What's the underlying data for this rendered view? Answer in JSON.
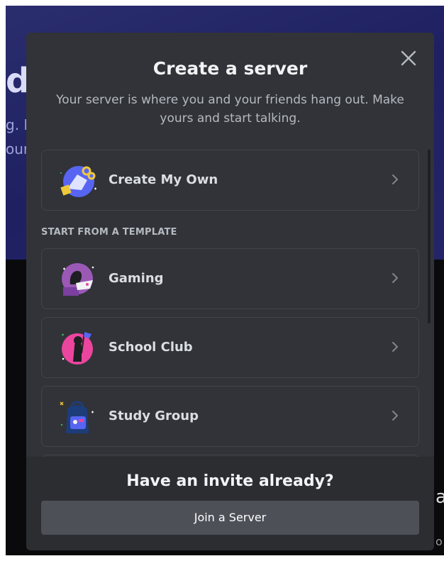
{
  "background": {
    "left_fragment_1": "d",
    "left_fragment_2": "g. F",
    "left_fragment_3": "our",
    "right_fragment_1": "a",
    "right_fragment_2": "o"
  },
  "modal": {
    "title": "Create a server",
    "subtitle": "Your server is where you and your friends hang out. Make yours and start talking.",
    "close_icon": "close-icon"
  },
  "options": {
    "create_own": {
      "label": "Create My Own",
      "icon": "create-server-icon"
    },
    "template_header": "START FROM A TEMPLATE",
    "templates": [
      {
        "label": "Gaming",
        "icon": "gaming-icon"
      },
      {
        "label": "School Club",
        "icon": "school-club-icon"
      },
      {
        "label": "Study Group",
        "icon": "study-group-icon"
      }
    ]
  },
  "footer": {
    "title": "Have an invite already?",
    "join_label": "Join a Server"
  },
  "colors": {
    "modal_bg": "#313338",
    "footer_bg": "#2b2d31",
    "button_bg": "#4e5058",
    "text_primary": "#f2f3f5",
    "text_muted": "#b5bac1"
  }
}
